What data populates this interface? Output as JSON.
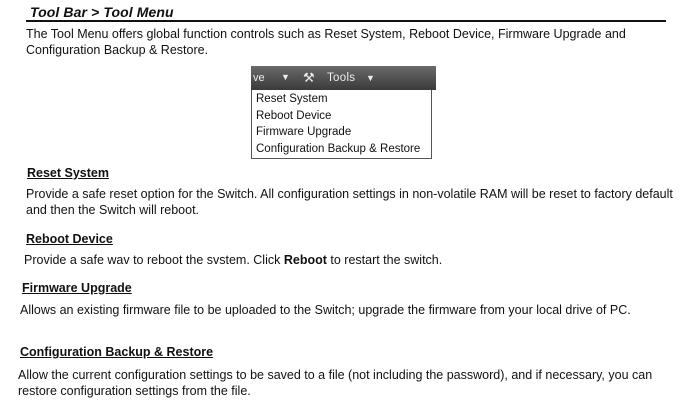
{
  "title": "Tool Bar > Tool Menu",
  "intro": "The Tool Menu offers global function controls such as Reset System, Reboot Device, Firmware Upgrade and Configuration Backup & Restore.",
  "menu_screenshot": {
    "bar_left_label": "ve",
    "tools_label": "Tools",
    "items": [
      "Reset System",
      "Reboot Device",
      "Firmware Upgrade",
      "Configuration Backup & Restore"
    ]
  },
  "sections": {
    "reset": {
      "heading": "Reset System",
      "body": "Provide a safe reset option for the Switch. All configuration settings in non-volatile RAM will be reset to factory default and then the Switch will reboot."
    },
    "reboot": {
      "heading": "Reboot Device",
      "body_before": "Provide a safe wav to reboot the svstem. Click ",
      "body_bold": "Reboot",
      "body_after": " to restart the switch."
    },
    "firmware": {
      "heading": "Firmware Upgrade",
      "body": "Allows an existing firmware file to be uploaded to the Switch; upgrade the firmware from your local drive of PC."
    },
    "config": {
      "heading": "Configuration Backup & Restore",
      "body": "Allow the current configuration settings to be saved to a file (not including the password), and if necessary, you can restore configuration settings from the file."
    }
  }
}
